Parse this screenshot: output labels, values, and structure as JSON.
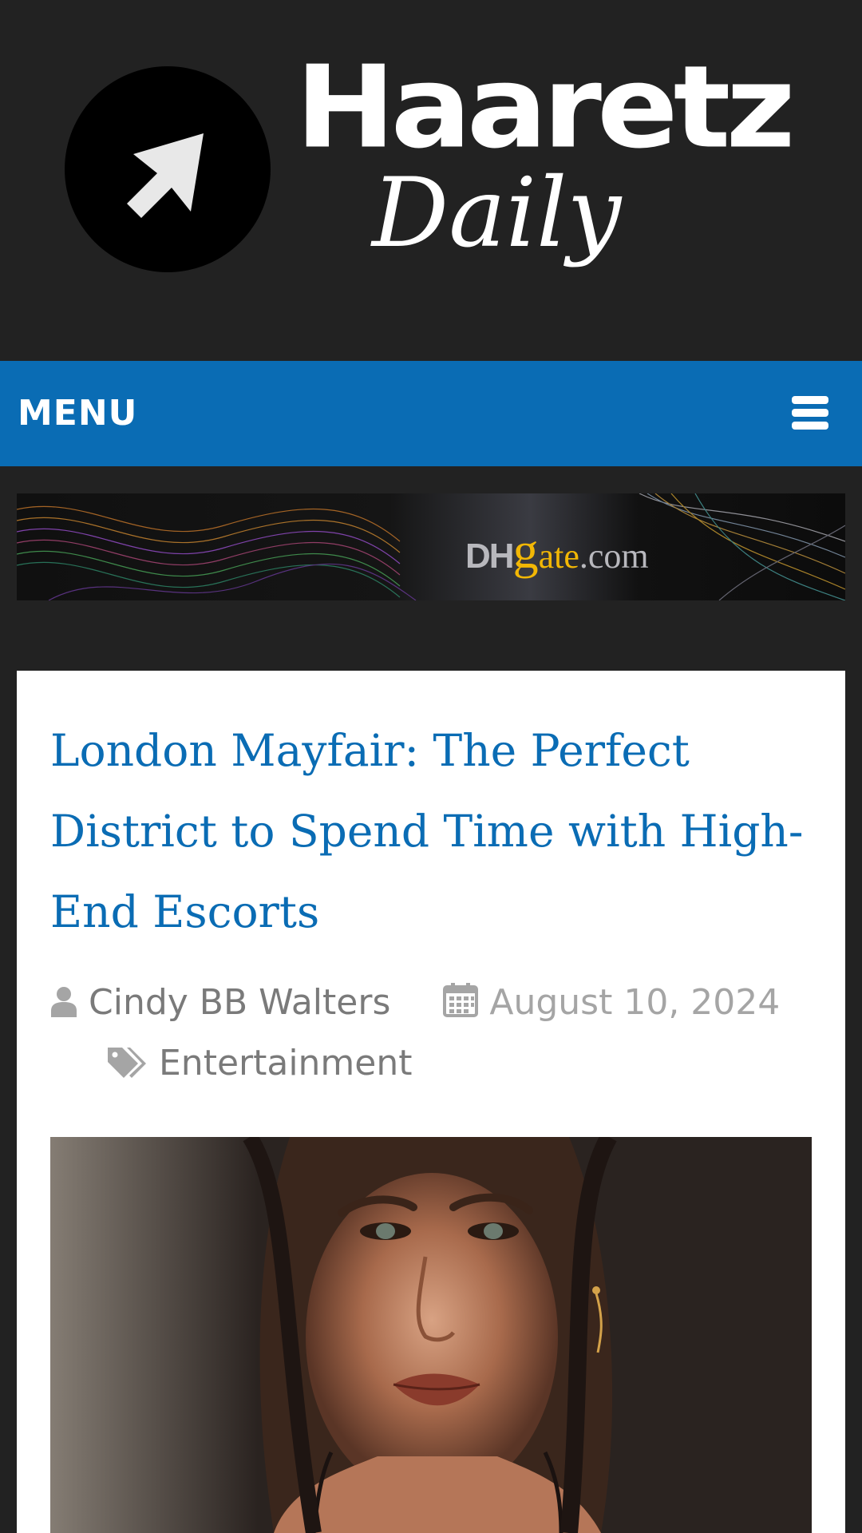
{
  "site": {
    "logo_word_1": "Haaretz",
    "logo_word_2": "Daily",
    "logo_icon": "cursor-arrow-icon"
  },
  "nav": {
    "menu_label": "MENU",
    "menu_icon": "hamburger-menu-icon"
  },
  "ad": {
    "brand_prefix": "DH",
    "brand_g": "g",
    "brand_rest": "ate",
    "brand_suffix": ".com"
  },
  "post": {
    "title": "London Mayfair: The Perfect District to Spend Time with High-End Escorts",
    "author": "Cindy BB Walters",
    "author_icon": "user-icon",
    "date": "August 10, 2024",
    "date_icon": "calendar-icon",
    "category": "Entertainment",
    "category_icon": "tags-icon",
    "image_alt": "portrait-photo"
  },
  "colors": {
    "page_background": "#222222",
    "nav_background": "#0a6cb4",
    "title_link": "#0a6cb4",
    "meta_text": "#a5a5a5",
    "card_background": "#ffffff",
    "ad_brand_yellow": "#f2b705"
  }
}
